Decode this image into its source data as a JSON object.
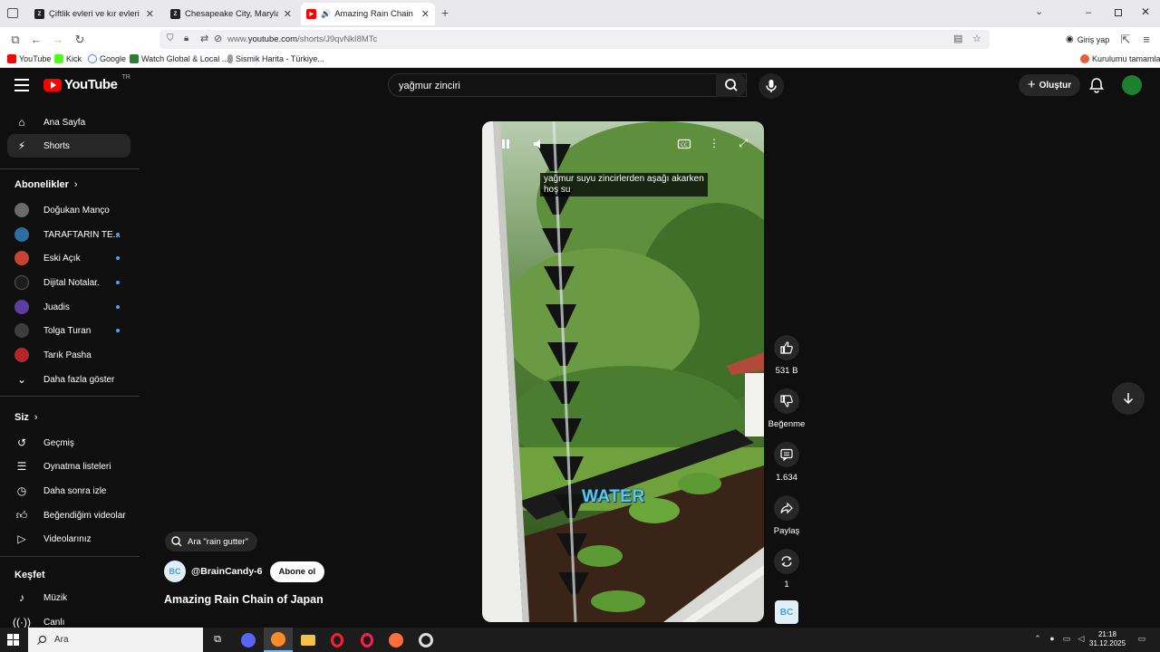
{
  "browser": {
    "tabs": [
      {
        "title": "Çiftlik evleri ve kır evleri satılık / ",
        "icon": "zillow-icon",
        "active": false
      },
      {
        "title": "Chesapeake City, Maryland, satı",
        "icon": "zillow-icon",
        "active": false
      },
      {
        "title": "Amazing Rain Chain of Japa",
        "icon": "youtube-icon",
        "active": true
      }
    ],
    "url_prefix": "www.",
    "url_host": "youtube.com",
    "url_path": "/shorts/J9qvNkI8MTc",
    "sign_in_label": "Giriş yap",
    "bookmarks": [
      {
        "label": "YouTube",
        "icon": "youtube-icon"
      },
      {
        "label": "Kick",
        "icon": "kick-icon"
      },
      {
        "label": "Google",
        "icon": "google-icon"
      },
      {
        "label": "Watch Global & Local ...",
        "icon": "watch-icon"
      },
      {
        "label": "Sismik Harita - Türkiye...",
        "icon": "map-pin-icon"
      }
    ],
    "bookmarks_right": "Kurulumu tamamla"
  },
  "youtube": {
    "logo_text": "YouTube",
    "region": "TR",
    "search_value": "yağmur zinciri",
    "create_label": "Oluştur",
    "nav": [
      {
        "label": "Ana Sayfa",
        "icon": "home-icon"
      },
      {
        "label": "Shorts",
        "icon": "shorts-icon",
        "active": true
      }
    ],
    "subscriptions_header": "Abonelikler",
    "subscriptions": [
      {
        "label": "Doğukan Manço",
        "color": "#6a6a6a",
        "dot": false
      },
      {
        "label": "TARAFTARIN TE...",
        "color": "#2b6e9f",
        "dot": true
      },
      {
        "label": "Eski Açık",
        "color": "#c8432f",
        "dot": true
      },
      {
        "label": "Dijital Notalar.",
        "color": "#1d1d1d",
        "dot": true
      },
      {
        "label": "Juadis",
        "color": "#5a3fa0",
        "dot": true
      },
      {
        "label": "Tolga Turan",
        "color": "#3d3d3d",
        "dot": true
      },
      {
        "label": "Tarık Pasha",
        "color": "#b02727",
        "dot": false
      }
    ],
    "show_more_label": "Daha fazla göster",
    "you_header": "Siz",
    "you_items": [
      {
        "label": "Geçmiş",
        "icon": "history-icon"
      },
      {
        "label": "Oynatma listeleri",
        "icon": "playlist-icon"
      },
      {
        "label": "Daha sonra izle",
        "icon": "clock-icon"
      },
      {
        "label": "Beğendiğim videolar",
        "icon": "thumbs-up-icon"
      },
      {
        "label": "Videolarınız",
        "icon": "video-icon"
      }
    ],
    "explore_header": "Keşfet",
    "explore_items": [
      {
        "label": "Müzik",
        "icon": "music-icon"
      },
      {
        "label": "Canlı",
        "icon": "live-icon"
      }
    ],
    "short": {
      "caption_line1": "yağmur suyu zincirlerden aşağı akarken",
      "caption_line2": "hoş su",
      "overlay_text": "WATER",
      "likes": "531 B",
      "dislike_label": "Beğenme",
      "comments": "1.634",
      "share_label": "Paylaş",
      "remix_count": "1",
      "channel_initials": "BC",
      "related_search": "Ara \"rain gutter\"",
      "channel_handle": "@BrainCandy-6",
      "subscribe_label": "Abone ol",
      "title": "Amazing Rain Chain of Japan"
    }
  },
  "taskbar": {
    "search_placeholder": "Ara",
    "time": "21:18",
    "date": "31.12.2025"
  }
}
